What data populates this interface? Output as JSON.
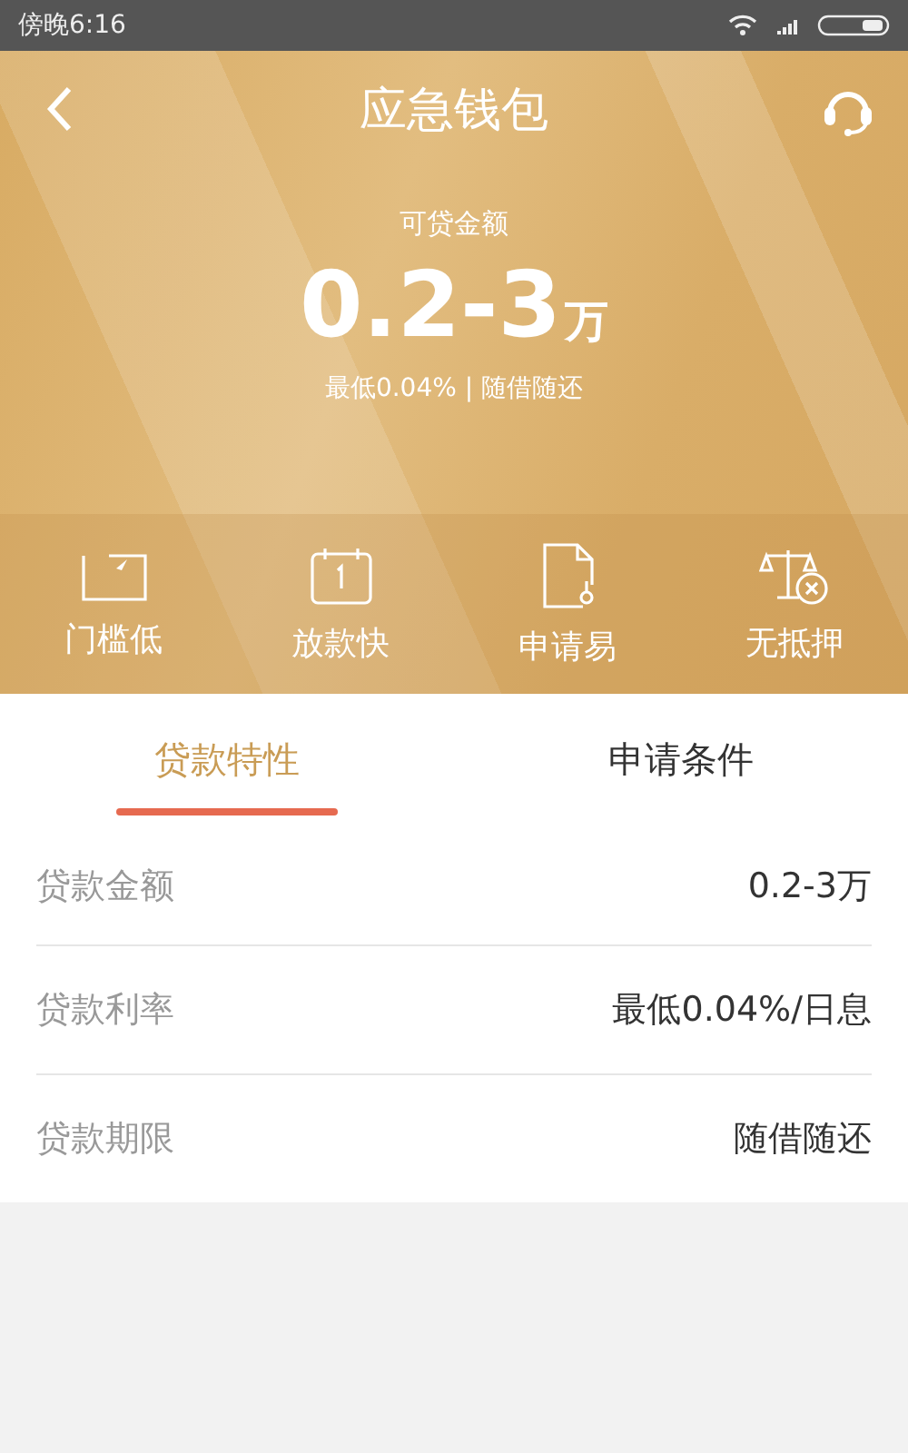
{
  "status_bar": {
    "time": "傍晚6:16"
  },
  "header": {
    "title": "应急钱包"
  },
  "summary": {
    "label": "可贷金额",
    "amount": "0.2-3",
    "unit": "万",
    "note": "最低0.04% | 随借随还"
  },
  "features": [
    {
      "kind": "threshold",
      "label": "门槛低"
    },
    {
      "kind": "calendar",
      "label": "放款快"
    },
    {
      "kind": "document",
      "label": "申请易"
    },
    {
      "kind": "scale",
      "label": "无抵押"
    }
  ],
  "tabs": [
    {
      "label": "贷款特性",
      "selected": true
    },
    {
      "label": "申请条件",
      "selected": false
    }
  ],
  "rows": [
    {
      "label": "贷款金额",
      "value": "0.2-3万"
    },
    {
      "label": "贷款利率",
      "value": "最低0.04%/日息"
    },
    {
      "label": "贷款期限",
      "value": "随借随还"
    }
  ]
}
